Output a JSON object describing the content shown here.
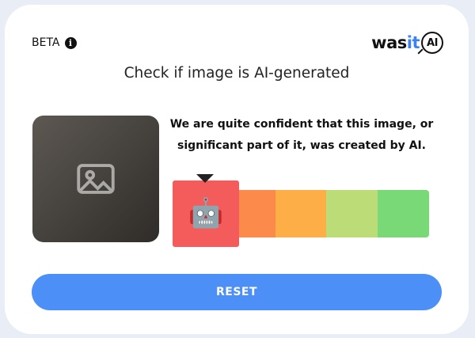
{
  "header": {
    "beta_label": "BETA",
    "info_icon": "i",
    "logo": {
      "prefix": "was",
      "accent": "it",
      "mark": "AI"
    }
  },
  "title": "Check if image is AI-generated",
  "image": {
    "icon": "photo-icon"
  },
  "result": {
    "line1": "We are quite confident that this image, or",
    "line2": "significant part of it, was created by AI.",
    "marker_icon": "🤖",
    "marker_level": "ai-generated",
    "scale_colors": [
      "#f45b5b",
      "#fb8a4b",
      "#fdae47",
      "#bcdc78",
      "#79d976"
    ]
  },
  "reset_label": "RESET"
}
